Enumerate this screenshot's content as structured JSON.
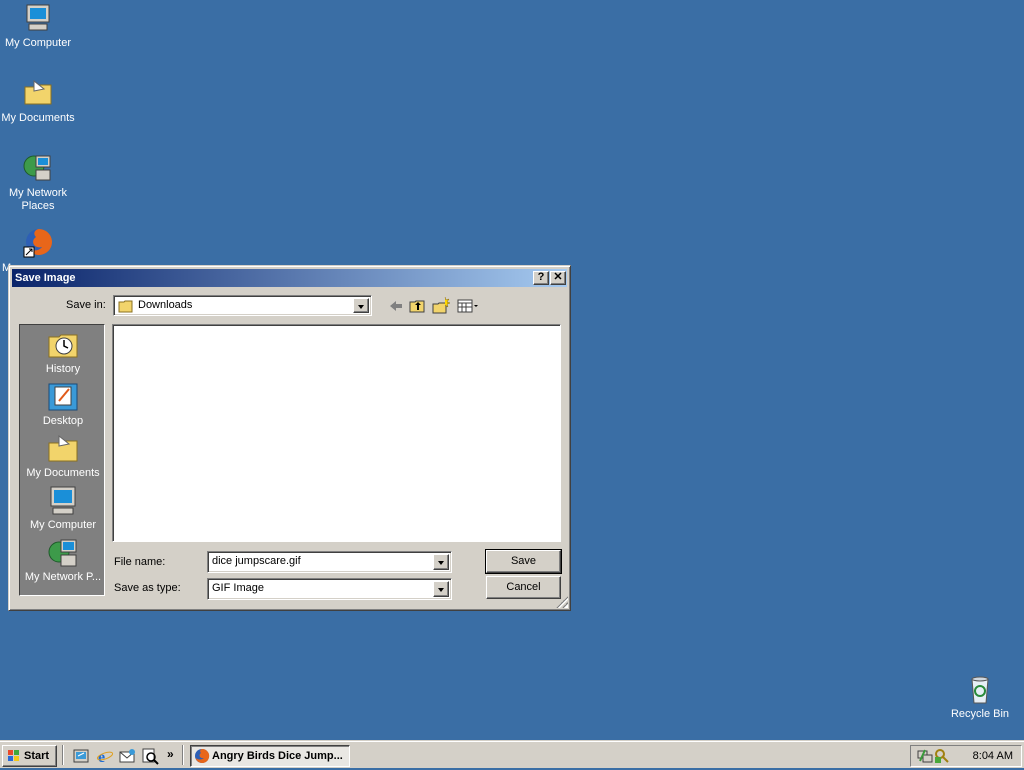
{
  "desktop": {
    "icons": [
      {
        "label": "My Computer"
      },
      {
        "label": "My Documents"
      },
      {
        "label": "My Network Places"
      },
      {
        "label": "M"
      },
      {
        "label": "Recycle Bin"
      }
    ]
  },
  "dialog": {
    "title": "Save Image",
    "help_button": "?",
    "close_button": "✕",
    "save_in_label": "Save in:",
    "save_in_value": "Downloads",
    "places": [
      {
        "label": "History",
        "icon": "history-icon"
      },
      {
        "label": "Desktop",
        "icon": "desktop-icon"
      },
      {
        "label": "My Documents",
        "icon": "my-documents-icon"
      },
      {
        "label": "My Computer",
        "icon": "my-computer-icon"
      },
      {
        "label": "My Network P...",
        "icon": "network-places-icon"
      }
    ],
    "file_name_label": "File name:",
    "file_name_value": "dice jumpscare.gif",
    "save_type_label": "Save as type:",
    "save_type_value": "GIF Image",
    "save_button": "Save",
    "cancel_button": "Cancel"
  },
  "taskbar": {
    "start_label": "Start",
    "chevron": "»",
    "task_label": "Angry Birds Dice Jump...",
    "clock": "8:04 AM"
  },
  "colors": {
    "desktop": "#3a6ea5",
    "titlebar_start": "#0a246a",
    "titlebar_end": "#a6caf0",
    "face": "#d4d0c8"
  }
}
